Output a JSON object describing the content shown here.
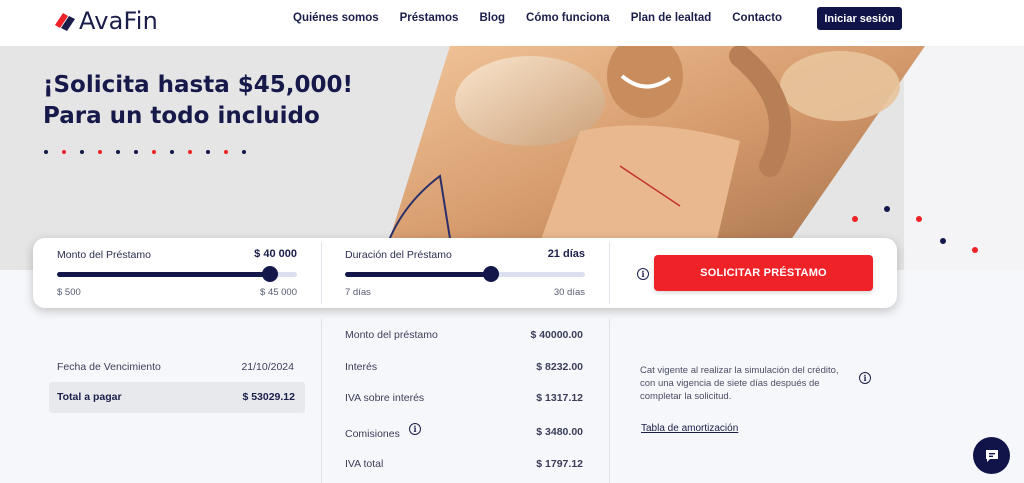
{
  "brand": {
    "name": "AvaFin"
  },
  "nav": {
    "items": [
      "Quiénes somos",
      "Préstamos",
      "Blog",
      "Cómo funciona",
      "Plan de lealtad",
      "Contacto"
    ],
    "login_label": "Iniciar sesión"
  },
  "hero": {
    "title_line1": "¡Solicita hasta $45,000!",
    "title_line2": "Para un todo incluido"
  },
  "calculator": {
    "amount": {
      "label": "Monto del Préstamo",
      "value": "$ 40 000",
      "min": "$ 500",
      "max": "$ 45 000",
      "fraction": 0.888
    },
    "duration": {
      "label": "Duración del Préstamo",
      "value": "21 días",
      "min": "7 días",
      "max": "30 días",
      "fraction": 0.609
    },
    "apply_label": "SOLICITAR PRÉSTAMO"
  },
  "summary": {
    "due_label": "Fecha de Vencimiento",
    "due_value": "21/10/2024",
    "total_label": "Total a pagar",
    "total_value": "$ 53029.12",
    "breakdown": [
      {
        "label": "Monto del préstamo",
        "value": "$ 40000.00"
      },
      {
        "label": "Interés",
        "value": "$ 8232.00"
      },
      {
        "label": "IVA sobre interés",
        "value": "$ 1317.12"
      },
      {
        "label": "Comisiones",
        "value": "$ 3480.00"
      },
      {
        "label": "IVA total",
        "value": "$ 1797.12"
      }
    ],
    "note": "Cat vigente al realizar la simulación del crédito, con una vigencia de siete días después de completar la solicitud.",
    "amortization_link": "Tabla de amortización"
  },
  "icons": [
    "logo-icon",
    "info-icon",
    "chat-icon"
  ],
  "colors": {
    "navy": "#13174a",
    "red": "#ef2228",
    "track": "#dcdff0"
  }
}
